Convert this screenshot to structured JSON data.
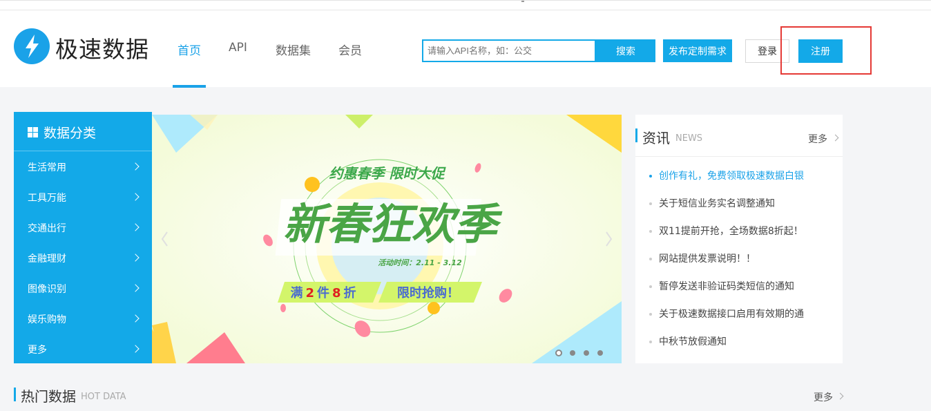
{
  "brand": {
    "name": "极速数据"
  },
  "nav": [
    {
      "label": "首页",
      "active": true
    },
    {
      "label": "API"
    },
    {
      "label": "数据集"
    },
    {
      "label": "会员"
    }
  ],
  "search": {
    "placeholder": "请输入API名称，如：公交",
    "button": "搜索"
  },
  "header_buttons": {
    "publish": "发布定制需求",
    "login": "登录",
    "register": "注册"
  },
  "category": {
    "title": "数据分类",
    "items": [
      "生活常用",
      "工具万能",
      "交通出行",
      "金融理财",
      "图像识别",
      "娱乐购物",
      "更多"
    ]
  },
  "banner": {
    "slogan": "约惠春季 限时大促",
    "headline": "新春狂欢季",
    "date": "活动时间：2.11 - 3.12",
    "offer_1": "满",
    "offer_2": "2",
    "offer_3": "件",
    "offer_4": "8",
    "offer_5": "折",
    "offer_cta": "限时抢购！",
    "slides": 4,
    "active_slide": 1
  },
  "news": {
    "title": "资讯",
    "subtitle": "NEWS",
    "more": "更多",
    "items": [
      "创作有礼，免费领取极速数据白银",
      "关于短信业务实名调整通知",
      "双11提前开抢，全场数据8折起！",
      "网站提供发票说明！！",
      "暂停发送非验证码类短信的通知",
      "关于极速数据接口启用有效期的通",
      "中秋节放假通知"
    ]
  },
  "hot": {
    "title": "热门数据",
    "subtitle": "HOT DATA",
    "more": "更多"
  },
  "colors": {
    "accent": "#13a9e8",
    "highlight": "#e53935"
  }
}
